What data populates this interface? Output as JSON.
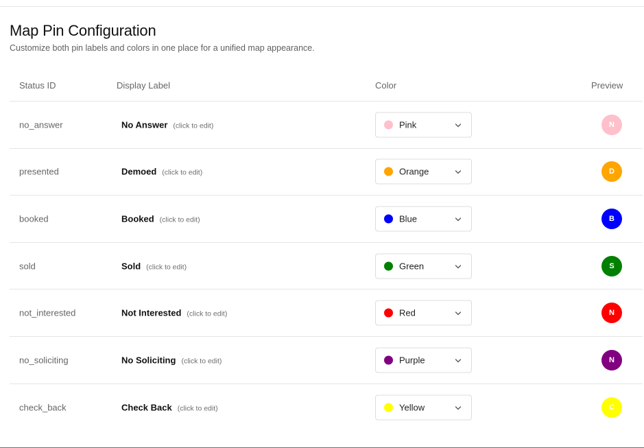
{
  "page": {
    "title": "Map Pin Configuration",
    "subtitle": "Customize both pin labels and colors in one place for a unified map appearance."
  },
  "table": {
    "headers": {
      "status_id": "Status ID",
      "display_label": "Display Label",
      "color": "Color",
      "preview": "Preview"
    },
    "rows": [
      {
        "status_id": "no_answer",
        "label": "No Answer",
        "edit_hint": "(click to edit)",
        "color_name": "Pink",
        "color_hex": "#ffc0cb",
        "preview_letter": "N"
      },
      {
        "status_id": "presented",
        "label": "Demoed",
        "edit_hint": "(click to edit)",
        "color_name": "Orange",
        "color_hex": "#ffa500",
        "preview_letter": "D"
      },
      {
        "status_id": "booked",
        "label": "Booked",
        "edit_hint": "(click to edit)",
        "color_name": "Blue",
        "color_hex": "#0000ff",
        "preview_letter": "B"
      },
      {
        "status_id": "sold",
        "label": "Sold",
        "edit_hint": "(click to edit)",
        "color_name": "Green",
        "color_hex": "#008000",
        "preview_letter": "S"
      },
      {
        "status_id": "not_interested",
        "label": "Not Interested",
        "edit_hint": "(click to edit)",
        "color_name": "Red",
        "color_hex": "#ff0000",
        "preview_letter": "N"
      },
      {
        "status_id": "no_soliciting",
        "label": "No Soliciting",
        "edit_hint": "(click to edit)",
        "color_name": "Purple",
        "color_hex": "#800080",
        "preview_letter": "N"
      },
      {
        "status_id": "check_back",
        "label": "Check Back",
        "edit_hint": "(click to edit)",
        "color_name": "Yellow",
        "color_hex": "#ffff00",
        "preview_letter": "C"
      }
    ]
  },
  "icons": {
    "dropdown": "chevron-down-icon"
  }
}
